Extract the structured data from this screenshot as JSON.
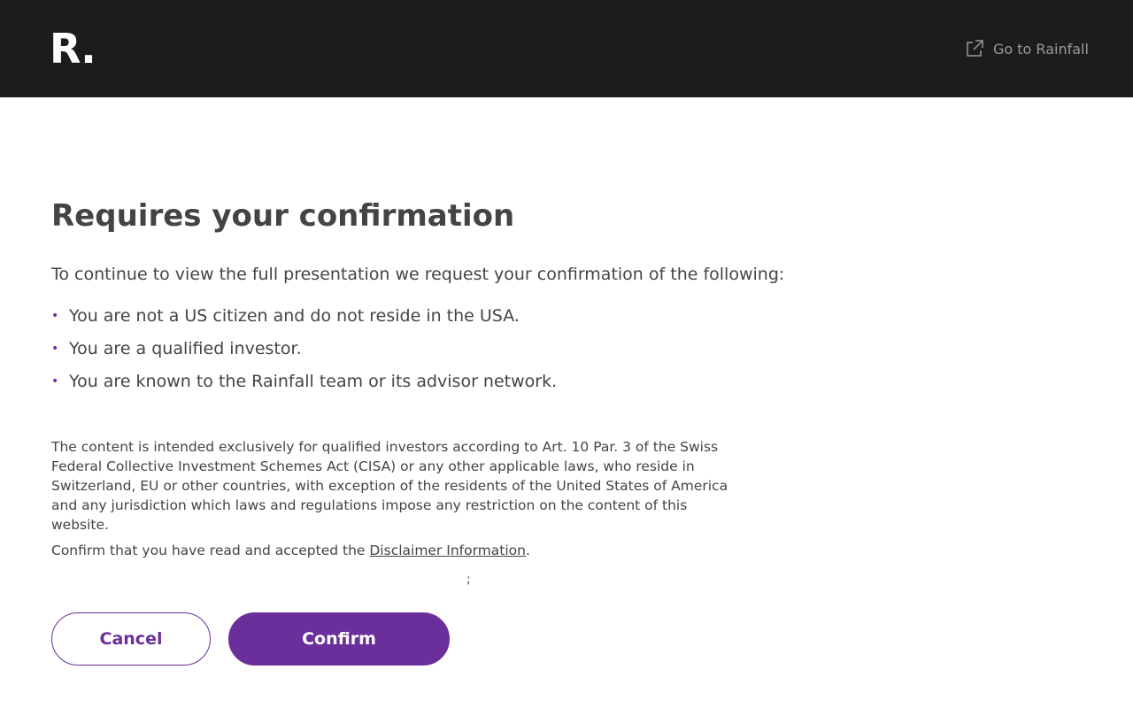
{
  "header": {
    "logo_text": "R.",
    "go_link_label": "Go to Rainfall",
    "go_link_icon": "external-link-icon"
  },
  "main": {
    "title": "Requires your confirmation",
    "intro": "To continue to view the full presentation we request your confirmation of the following:",
    "bullets": [
      "You are not a US citizen and do not reside in the USA.",
      "You are a qualified investor.",
      "You are known to the Rainfall team or its advisor network."
    ],
    "legal_text": "The content is intended exclusively for qualified investors according to Art. 10 Par. 3 of the Swiss Federal Collective Investment Schemes Act (CISA) or any other applicable laws, who reside in Switzerland, EU or other countries, with exception of the residents of the United States of America and any jurisdiction which laws and regulations impose any restriction on the content of this website.",
    "confirm_prefix": "Confirm that you have read and accepted the ",
    "disclaimer_link": "Disclaimer Information",
    "confirm_suffix": ".",
    "stray_text": ";"
  },
  "actions": {
    "cancel_label": "Cancel",
    "confirm_label": "Confirm"
  },
  "colors": {
    "header_bg": "#1c1c1c",
    "accent": "#6a2f9a",
    "text": "#444444",
    "muted": "#9a9a9a"
  }
}
